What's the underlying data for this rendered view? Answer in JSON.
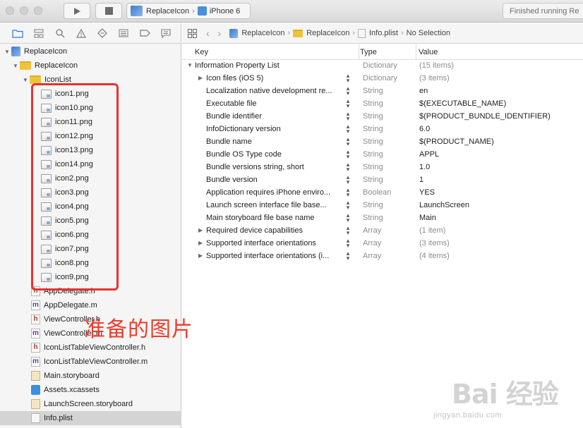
{
  "toolbar": {
    "scheme_project": "ReplaceIcon",
    "scheme_device": "iPhone 6",
    "status": "Finished running Re"
  },
  "navigator": {
    "project": "ReplaceIcon",
    "group": "ReplaceIcon",
    "subgroup": "IconList",
    "icons": [
      "icon1.png",
      "icon10.png",
      "icon11.png",
      "icon12.png",
      "icon13.png",
      "icon14.png",
      "icon2.png",
      "icon3.png",
      "icon4.png",
      "icon5.png",
      "icon6.png",
      "icon7.png",
      "icon8.png",
      "icon9.png"
    ],
    "files": [
      {
        "name": "AppDelegate.h",
        "kind": "h"
      },
      {
        "name": "AppDelegate.m",
        "kind": "m"
      },
      {
        "name": "ViewController.h",
        "kind": "h"
      },
      {
        "name": "ViewController.m",
        "kind": "m"
      },
      {
        "name": "IconListTableViewController.h",
        "kind": "h"
      },
      {
        "name": "IconListTableViewController.m",
        "kind": "m"
      },
      {
        "name": "Main.storyboard",
        "kind": "storyboard"
      },
      {
        "name": "Assets.xcassets",
        "kind": "assets"
      },
      {
        "name": "LaunchScreen.storyboard",
        "kind": "storyboard"
      },
      {
        "name": "Info.plist",
        "kind": "plist",
        "selected": true
      }
    ]
  },
  "annotation": "准备的图片",
  "jumpbar": {
    "crumbs": [
      "ReplaceIcon",
      "ReplaceIcon",
      "Info.plist",
      "No Selection"
    ]
  },
  "plist": {
    "columns": {
      "key": "Key",
      "type": "Type",
      "value": "Value"
    },
    "rows": [
      {
        "key": "Information Property List",
        "type": "Dictionary",
        "value": "(15 items)",
        "level": 0,
        "disclosure": "open",
        "muted": true
      },
      {
        "key": "Icon files (iOS 5)",
        "type": "Dictionary",
        "value": "(3 items)",
        "level": 1,
        "disclosure": "closed",
        "muted": true
      },
      {
        "key": "Localization native development re...",
        "type": "String",
        "value": "en",
        "level": 1,
        "disclosure": "none"
      },
      {
        "key": "Executable file",
        "type": "String",
        "value": "$(EXECUTABLE_NAME)",
        "level": 1,
        "disclosure": "none"
      },
      {
        "key": "Bundle identifier",
        "type": "String",
        "value": "$(PRODUCT_BUNDLE_IDENTIFIER)",
        "level": 1,
        "disclosure": "none"
      },
      {
        "key": "InfoDictionary version",
        "type": "String",
        "value": "6.0",
        "level": 1,
        "disclosure": "none"
      },
      {
        "key": "Bundle name",
        "type": "String",
        "value": "$(PRODUCT_NAME)",
        "level": 1,
        "disclosure": "none"
      },
      {
        "key": "Bundle OS Type code",
        "type": "String",
        "value": "APPL",
        "level": 1,
        "disclosure": "none"
      },
      {
        "key": "Bundle versions string, short",
        "type": "String",
        "value": "1.0",
        "level": 1,
        "disclosure": "none"
      },
      {
        "key": "Bundle version",
        "type": "String",
        "value": "1",
        "level": 1,
        "disclosure": "none"
      },
      {
        "key": "Application requires iPhone enviro...",
        "type": "Boolean",
        "value": "YES",
        "level": 1,
        "disclosure": "none"
      },
      {
        "key": "Launch screen interface file base...",
        "type": "String",
        "value": "LaunchScreen",
        "level": 1,
        "disclosure": "none"
      },
      {
        "key": "Main storyboard file base name",
        "type": "String",
        "value": "Main",
        "level": 1,
        "disclosure": "none"
      },
      {
        "key": "Required device capabilities",
        "type": "Array",
        "value": "(1 item)",
        "level": 1,
        "disclosure": "closed",
        "muted": true
      },
      {
        "key": "Supported interface orientations",
        "type": "Array",
        "value": "(3 items)",
        "level": 1,
        "disclosure": "closed",
        "muted": true
      },
      {
        "key": "Supported interface orientations (i...",
        "type": "Array",
        "value": "(4 items)",
        "level": 1,
        "disclosure": "closed",
        "muted": true
      }
    ]
  },
  "watermark": {
    "logo_text": "Bai 经验",
    "url": "jingyan.baidu.com"
  }
}
